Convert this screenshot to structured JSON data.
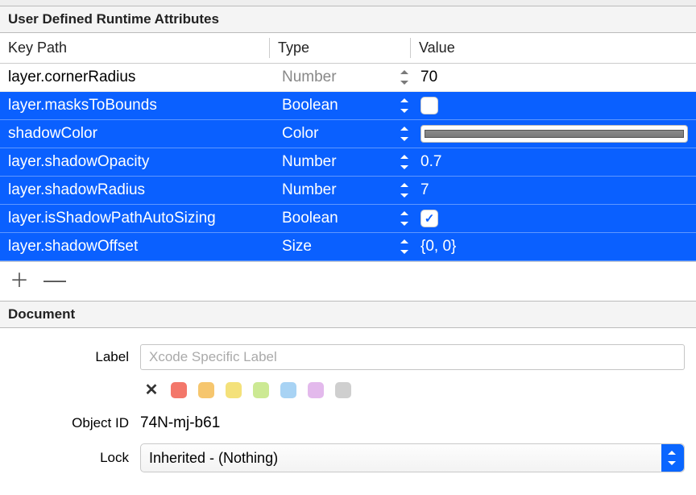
{
  "runtime_attributes": {
    "section_title": "User Defined Runtime Attributes",
    "columns": {
      "key": "Key Path",
      "type": "Type",
      "value": "Value"
    },
    "rows": [
      {
        "selected": false,
        "key": "layer.cornerRadius",
        "type": "Number",
        "value_kind": "text",
        "value": "70"
      },
      {
        "selected": true,
        "key": "layer.masksToBounds",
        "type": "Boolean",
        "value_kind": "checkbox",
        "checked": false
      },
      {
        "selected": true,
        "key": "shadowColor",
        "type": "Color",
        "value_kind": "color",
        "color": "#7a7a7a"
      },
      {
        "selected": true,
        "key": "layer.shadowOpacity",
        "type": "Number",
        "value_kind": "text",
        "value": "0.7"
      },
      {
        "selected": true,
        "key": "layer.shadowRadius",
        "type": "Number",
        "value_kind": "text",
        "value": "7"
      },
      {
        "selected": true,
        "key": "layer.isShadowPathAutoSizing",
        "type": "Boolean",
        "value_kind": "checkbox",
        "checked": true
      },
      {
        "selected": true,
        "key": "layer.shadowOffset",
        "type": "Size",
        "value_kind": "text",
        "value": "{0, 0}"
      }
    ]
  },
  "document": {
    "section_title": "Document",
    "label_field": {
      "label": "Label",
      "value": "",
      "placeholder": "Xcode Specific Label"
    },
    "object_id": {
      "label": "Object ID",
      "value": "74N-mj-b61"
    },
    "lock": {
      "label": "Lock",
      "selected": "Inherited - (Nothing)"
    }
  }
}
